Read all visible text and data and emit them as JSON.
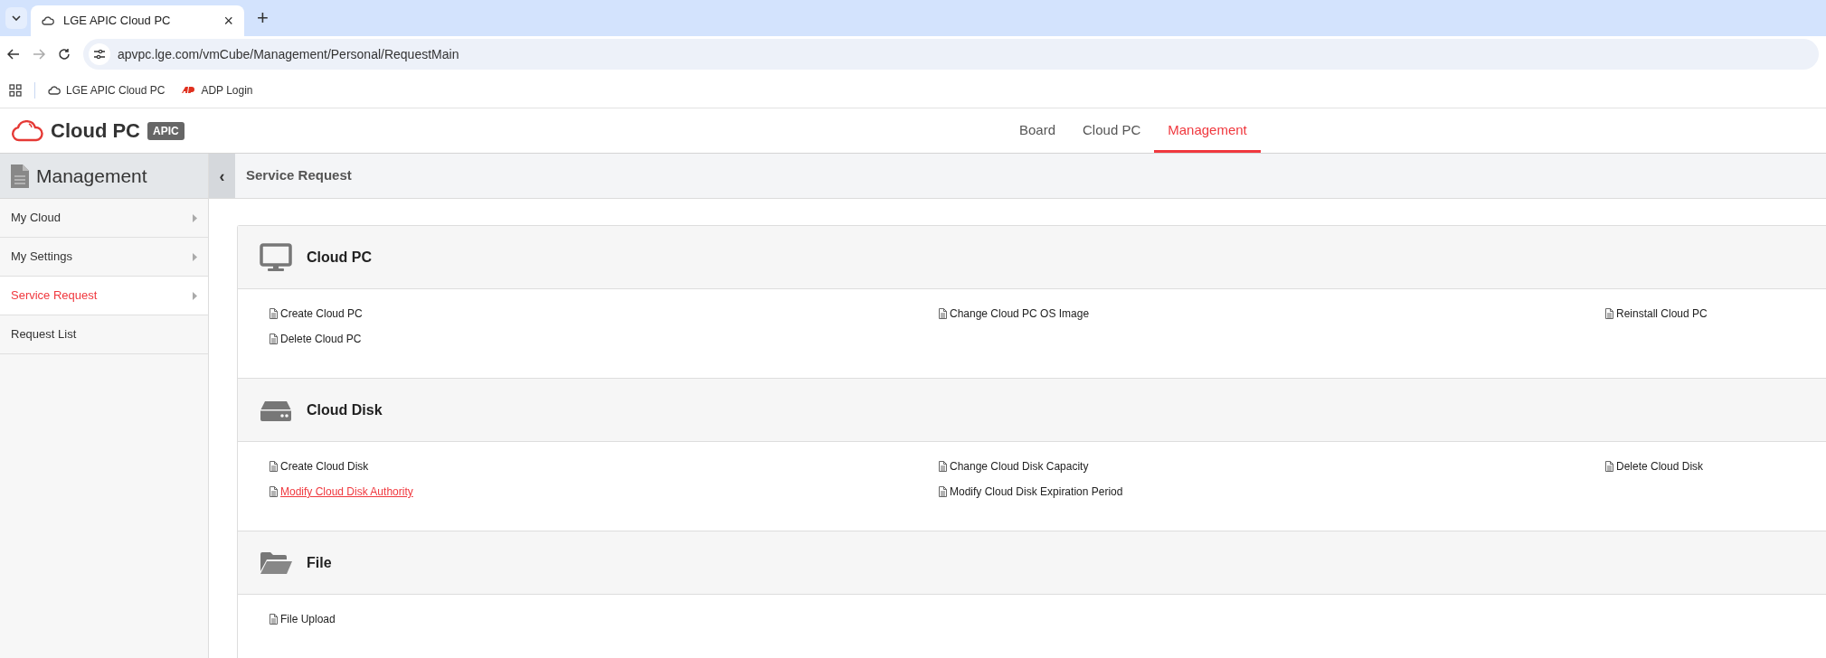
{
  "browser": {
    "tab": {
      "title": "LGE APIC Cloud PC",
      "close": "×"
    },
    "new_tab": "+",
    "address": "apvpc.lge.com/vmCube/Management/Personal/RequestMain",
    "bookmarks": [
      {
        "label": "LGE APIC Cloud PC",
        "kind": "cloud"
      },
      {
        "label": "ADP Login",
        "kind": "adp"
      }
    ]
  },
  "header": {
    "logo": {
      "name": "Cloud PC",
      "badge": "APIC"
    },
    "nav": [
      {
        "label": "Board",
        "selected": false
      },
      {
        "label": "Cloud PC",
        "selected": false
      },
      {
        "label": "Management",
        "selected": true
      }
    ]
  },
  "sidebar": {
    "title": "Management",
    "items": [
      {
        "label": "My Cloud",
        "selected": false,
        "expandable": true
      },
      {
        "label": "My Settings",
        "selected": false,
        "expandable": true
      },
      {
        "label": "Service Request",
        "selected": true,
        "expandable": true
      },
      {
        "label": "Request List",
        "selected": false,
        "expandable": false
      }
    ]
  },
  "breadcrumb": {
    "collapse": "‹",
    "title": "Service Request"
  },
  "sections": [
    {
      "title": "Cloud PC",
      "kind": "monitor",
      "links": [
        {
          "label": "Create Cloud PC",
          "highlighted": false
        },
        {
          "label": "Change Cloud PC OS Image",
          "highlighted": false
        },
        {
          "label": "Reinstall Cloud PC",
          "highlighted": false
        },
        {
          "label": "Delete Cloud PC",
          "highlighted": false
        }
      ]
    },
    {
      "title": "Cloud Disk",
      "kind": "disk",
      "links": [
        {
          "label": "Create Cloud Disk",
          "highlighted": false
        },
        {
          "label": "Change Cloud Disk Capacity",
          "highlighted": false
        },
        {
          "label": "Delete Cloud Disk",
          "highlighted": false
        },
        {
          "label": "Modify Cloud Disk Authority",
          "highlighted": true
        },
        {
          "label": "Modify Cloud Disk Expiration Period",
          "highlighted": false
        }
      ]
    },
    {
      "title": "File",
      "kind": "folder",
      "links": [
        {
          "label": "File Upload",
          "highlighted": false
        }
      ]
    }
  ]
}
